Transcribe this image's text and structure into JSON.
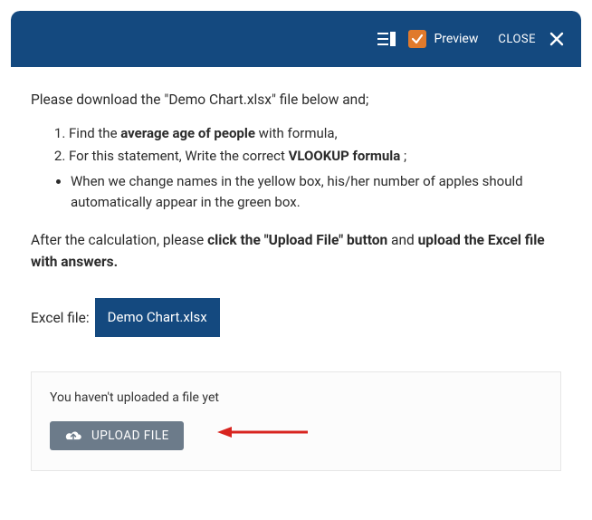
{
  "header": {
    "preview_label": "Preview",
    "close_label": "CLOSE"
  },
  "content": {
    "intro": "Please download the \"Demo Chart.xlsx\" file below and;",
    "step1_pre": "Find the ",
    "step1_bold": "average age of people",
    "step1_post": " with formula,",
    "step2_pre": "For this statement, Write the correct ",
    "step2_bold": "VLOOKUP formula",
    "step2_post": " ;",
    "substep": "When we change names in the yellow box, his/her number of apples should automatically appear in the green box.",
    "after_pre": "After the calculation, please ",
    "after_bold1": "click the \"Upload File\" button",
    "after_mid": " and ",
    "after_bold2": "upload the Excel file with answers.",
    "excel_label": "Excel file: ",
    "excel_filename": "Demo Chart.xlsx"
  },
  "upload": {
    "empty_message": "You haven't uploaded a file yet",
    "button_label": "UPLOAD FILE"
  }
}
